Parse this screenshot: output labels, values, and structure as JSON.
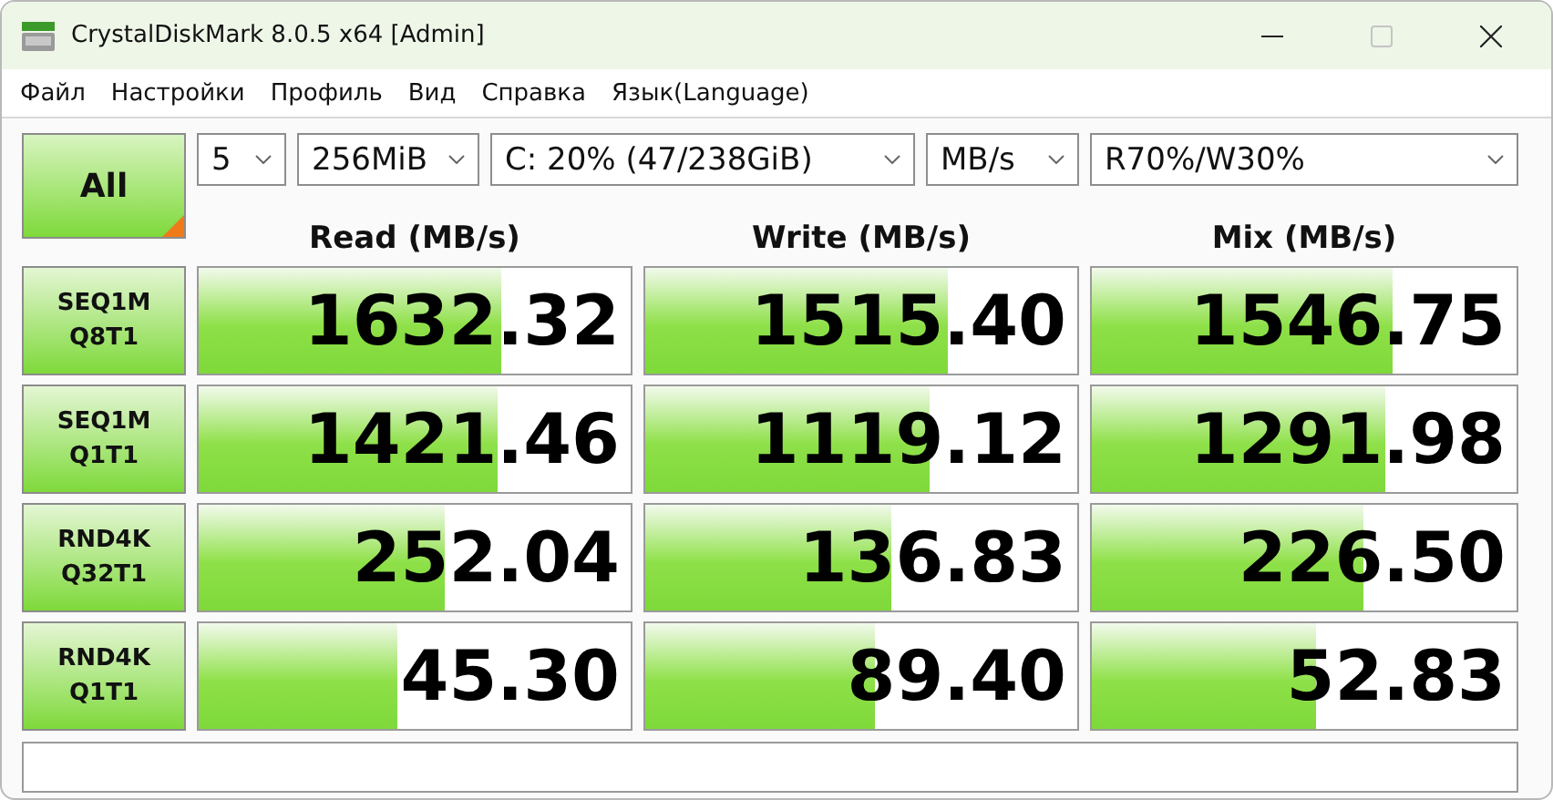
{
  "window": {
    "title": "CrystalDiskMark 8.0.5 x64 [Admin]",
    "maximize_disabled": true
  },
  "menu": [
    "Файл",
    "Настройки",
    "Профиль",
    "Вид",
    "Справка",
    "Язык(Language)"
  ],
  "all_button": {
    "label": "All"
  },
  "selects": [
    "5",
    "256MiB",
    "C: 20% (47/238GiB)",
    "MB/s"
  ],
  "mix_select": "R70%/W30%",
  "columns": [
    "Read (MB/s)",
    "Write (MB/s)",
    "Mix (MB/s)"
  ],
  "rows": [
    {
      "test": [
        "SEQ1M",
        "Q8T1"
      ],
      "results": [
        {
          "value": "1632.32",
          "level": 0.7
        },
        {
          "value": "1515.40",
          "level": 0.7
        },
        {
          "value": "1546.75",
          "level": 0.71
        }
      ]
    },
    {
      "test": [
        "SEQ1M",
        "Q1T1"
      ],
      "results": [
        {
          "value": "1421.46",
          "level": 0.69
        },
        {
          "value": "1119.12",
          "level": 0.66
        },
        {
          "value": "1291.98",
          "level": 0.69
        }
      ]
    },
    {
      "test": [
        "RND4K",
        "Q32T1"
      ],
      "results": [
        {
          "value": "252.04",
          "level": 0.57
        },
        {
          "value": "136.83",
          "level": 0.57
        },
        {
          "value": "226.50",
          "level": 0.64
        }
      ]
    },
    {
      "test": [
        "RND4K",
        "Q1T1"
      ],
      "results": [
        {
          "value": "45.30",
          "level": 0.46
        },
        {
          "value": "89.40",
          "level": 0.53
        },
        {
          "value": "52.83",
          "level": 0.53
        }
      ]
    }
  ]
}
